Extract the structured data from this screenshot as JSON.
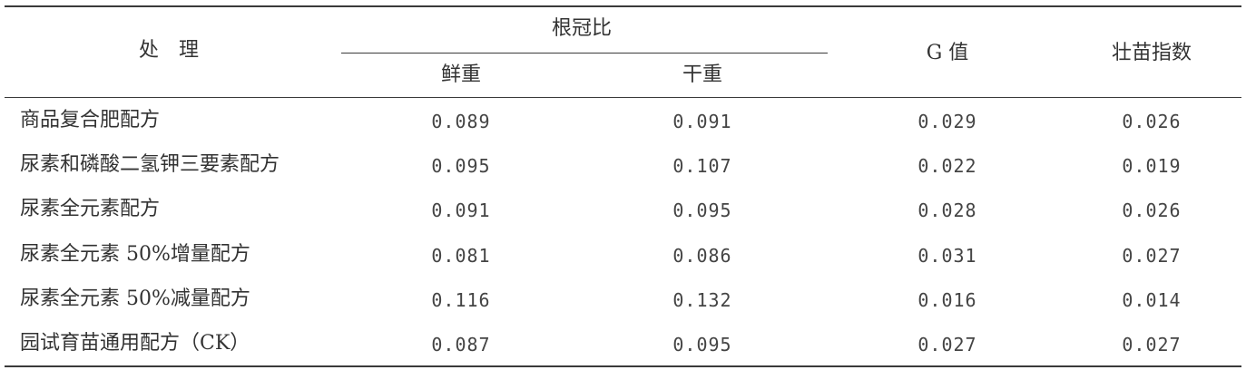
{
  "table": {
    "headers": {
      "treatment": "处　理",
      "root_shoot_ratio": "根冠比",
      "fresh_weight": "鲜重",
      "dry_weight": "干重",
      "g_value": "G 值",
      "seedling_index": "壮苗指数"
    },
    "rows": [
      {
        "label": "商品复合肥配方",
        "fresh": "0.089",
        "dry": "0.091",
        "g": "0.029",
        "index": "0.026"
      },
      {
        "label": "尿素和磷酸二氢钾三要素配方",
        "fresh": "0.095",
        "dry": "0.107",
        "g": "0.022",
        "index": "0.019"
      },
      {
        "label": "尿素全元素配方",
        "fresh": "0.091",
        "dry": "0.095",
        "g": "0.028",
        "index": "0.026"
      },
      {
        "label": "尿素全元素 50%增量配方",
        "fresh": "0.081",
        "dry": "0.086",
        "g": "0.031",
        "index": "0.027"
      },
      {
        "label": "尿素全元素 50%减量配方",
        "fresh": "0.116",
        "dry": "0.132",
        "g": "0.016",
        "index": "0.014"
      },
      {
        "label": "园试育苗通用配方（CK）",
        "fresh": "0.087",
        "dry": "0.095",
        "g": "0.027",
        "index": "0.027"
      }
    ]
  }
}
